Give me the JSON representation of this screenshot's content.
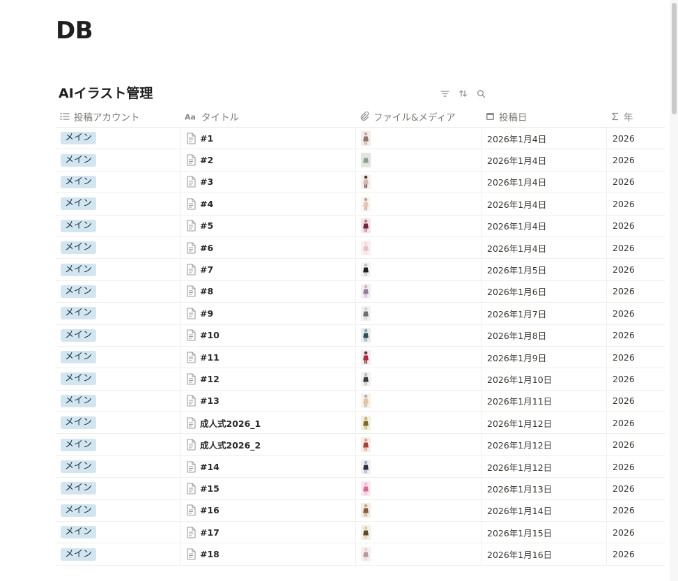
{
  "page": {
    "title": "DB"
  },
  "database": {
    "title": "AIイラスト管理"
  },
  "columns": [
    {
      "label": "投稿アカウント",
      "icon": "list-icon"
    },
    {
      "label": "タイトル",
      "icon": "text-aa-icon"
    },
    {
      "label": "ファイル&メディア",
      "icon": "paperclip-icon"
    },
    {
      "label": "投稿日",
      "icon": "calendar-icon"
    },
    {
      "label": "年",
      "icon": "sigma-icon"
    }
  ],
  "rows": [
    {
      "account": "メイン",
      "title": "#1",
      "date": "2026年1月4日",
      "year": "2026",
      "thumb": [
        "#f3ece8",
        "#8a7a72",
        "#c9a7a0"
      ]
    },
    {
      "account": "メイン",
      "title": "#2",
      "date": "2026年1月4日",
      "year": "2026",
      "thumb": [
        "#dfe6df",
        "#8e9e8c",
        "#e9e2d7"
      ]
    },
    {
      "account": "メイン",
      "title": "#3",
      "date": "2026年1月4日",
      "year": "2026",
      "thumb": [
        "#f7f1ee",
        "#d7b9b3",
        "#4a3b38"
      ]
    },
    {
      "account": "メイン",
      "title": "#4",
      "date": "2026年1月4日",
      "year": "2026",
      "thumb": [
        "#faf5f0",
        "#e2c8b7",
        "#c7a091"
      ]
    },
    {
      "account": "メイン",
      "title": "#5",
      "date": "2026年1月4日",
      "year": "2026",
      "thumb": [
        "#f2e6ea",
        "#6b2b3a",
        "#c47c8e"
      ]
    },
    {
      "account": "メイン",
      "title": "#6",
      "date": "2026年1月4日",
      "year": "2026",
      "thumb": [
        "#fbeff2",
        "#eac1cb",
        "#f3d9de"
      ]
    },
    {
      "account": "メイン",
      "title": "#7",
      "date": "2026年1月5日",
      "year": "2026",
      "thumb": [
        "#f4f4f4",
        "#1f1f1f",
        "#bfbfbf"
      ]
    },
    {
      "account": "メイン",
      "title": "#8",
      "date": "2026年1月6日",
      "year": "2026",
      "thumb": [
        "#f3eef2",
        "#9a7aa0",
        "#d2b4cf"
      ]
    },
    {
      "account": "メイン",
      "title": "#9",
      "date": "2026年1月7日",
      "year": "2026",
      "thumb": [
        "#f1f1f1",
        "#6e6e6e",
        "#d0cfcf"
      ]
    },
    {
      "account": "メイン",
      "title": "#10",
      "date": "2026年1月8日",
      "year": "2026",
      "thumb": [
        "#e8eef0",
        "#2d4f5c",
        "#8aa5ae"
      ]
    },
    {
      "account": "メイン",
      "title": "#11",
      "date": "2026年1月9日",
      "year": "2026",
      "thumb": [
        "#f6eeee",
        "#b8263a",
        "#5a3535"
      ]
    },
    {
      "account": "メイン",
      "title": "#12",
      "date": "2026年1月10日",
      "year": "2026",
      "thumb": [
        "#f2f2f2",
        "#3a3a3a",
        "#bbbbbb"
      ]
    },
    {
      "account": "メイン",
      "title": "#13",
      "date": "2026年1月11日",
      "year": "2026",
      "thumb": [
        "#fbf1e6",
        "#e7c49a",
        "#9fb3c9"
      ]
    },
    {
      "account": "メイン",
      "title": "成人式2026_1",
      "date": "2026年1月12日",
      "year": "2026",
      "thumb": [
        "#f3f0e2",
        "#7a6a2f",
        "#c9b36a"
      ]
    },
    {
      "account": "メイン",
      "title": "成人式2026_2",
      "date": "2026年1月12日",
      "year": "2026",
      "thumb": [
        "#f7ece6",
        "#a3413a",
        "#d9a38f"
      ]
    },
    {
      "account": "メイン",
      "title": "#14",
      "date": "2026年1月12日",
      "year": "2026",
      "thumb": [
        "#f0f0f2",
        "#2b2f45",
        "#a7a9b8"
      ]
    },
    {
      "account": "メイン",
      "title": "#15",
      "date": "2026年1月13日",
      "year": "2026",
      "thumb": [
        "#fbe9f0",
        "#d76a97",
        "#f2b5cc"
      ]
    },
    {
      "account": "メイン",
      "title": "#16",
      "date": "2026年1月14日",
      "year": "2026",
      "thumb": [
        "#f3ece6",
        "#8a5a3a",
        "#c9a587"
      ]
    },
    {
      "account": "メイン",
      "title": "#17",
      "date": "2026年1月15日",
      "year": "2026",
      "thumb": [
        "#f4efe6",
        "#5a4b2a",
        "#e0c79a"
      ]
    },
    {
      "account": "メイン",
      "title": "#18",
      "date": "2026年1月16日",
      "year": "2026",
      "thumb": [
        "#f6f0f0",
        "#b99a9a",
        "#e6d3d3"
      ]
    }
  ],
  "colors": {
    "tag_bg": "#d3e5ef",
    "tag_text": "#183347",
    "header_text": "#7b7b78",
    "border": "#e9e9e7"
  },
  "toolbar": [
    {
      "icon": "filter-icon"
    },
    {
      "icon": "sort-icon"
    },
    {
      "icon": "search-icon"
    }
  ]
}
